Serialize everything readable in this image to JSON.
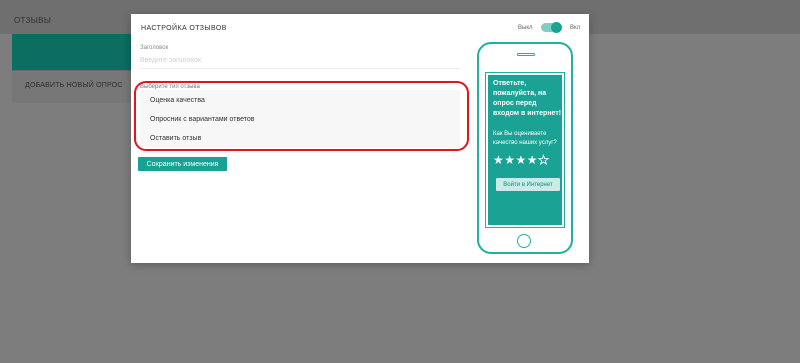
{
  "background_page": {
    "title": "Отзывы",
    "add_label": "Добавить новый опрос"
  },
  "modal": {
    "title": "Настройка отзывов",
    "toggle": {
      "off_label": "Выкл",
      "on_label": "Вкл",
      "state": "on"
    },
    "header_field": {
      "label": "Заголовок",
      "placeholder": "Введите заголовок"
    },
    "type_label": "Выберите тип отзыва",
    "options": [
      "Оценка качества",
      "Опросник с вариантами ответов",
      "Оставить отзыв"
    ],
    "save_label": "Сохранить изменения"
  },
  "preview": {
    "heading": "Ответьте, пожалуйста, на опрос перед входом в интернет!",
    "question": "Как Вы оцениваете качество наших услуг?",
    "rating": {
      "filled": 4,
      "total": 5
    },
    "button_label": "Войти в Интернет"
  },
  "colors": {
    "accent": "#1aa394",
    "highlight": "#e2141c",
    "overlay": "#7d7d7d"
  }
}
